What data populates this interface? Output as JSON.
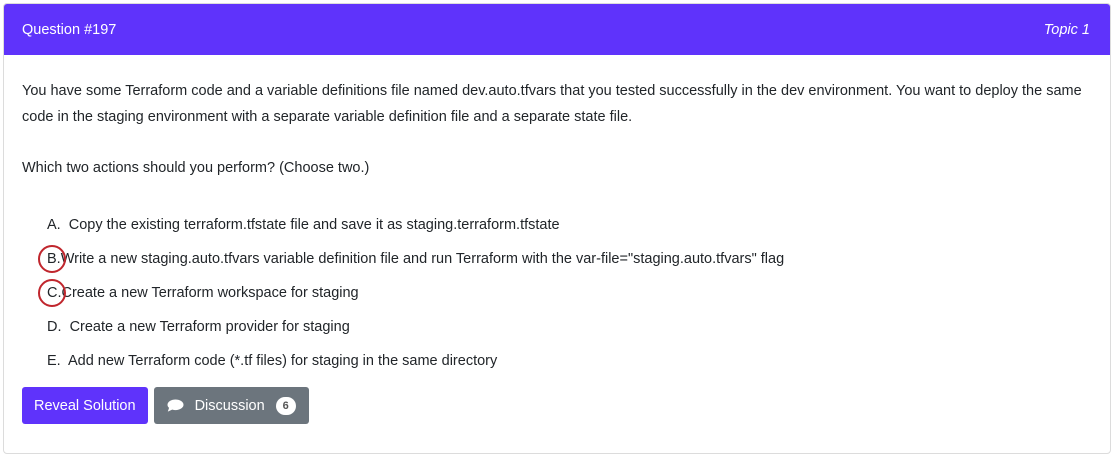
{
  "header": {
    "question_number": "Question #197",
    "topic": "Topic 1"
  },
  "question": {
    "paragraph1": "You have some Terraform code and a variable definitions file named dev.auto.tfvars that you tested successfully in the dev environment. You want to deploy the same code in the staging environment with a separate variable definition file and a separate state file.",
    "paragraph2": "Which two actions should you perform? (Choose two.)"
  },
  "choices": [
    {
      "letter": "A.",
      "text": "Copy the existing terraform.tfstate file and save it as staging.terraform.tfstate",
      "voted": false
    },
    {
      "letter": "B.",
      "text": "Write a new staging.auto.tfvars variable definition file and run Terraform with the var-file=\"staging.auto.tfvars\" flag",
      "voted": true
    },
    {
      "letter": "C.",
      "text": "Create a new Terraform workspace for staging",
      "voted": true
    },
    {
      "letter": "D.",
      "text": "Create a new Terraform provider for staging",
      "voted": false
    },
    {
      "letter": "E.",
      "text": "Add new Terraform code (*.tf files) for staging in the same directory",
      "voted": false
    }
  ],
  "actions": {
    "reveal_label": "Reveal Solution",
    "discussion_label": "Discussion",
    "discussion_count": "6",
    "discussion_icon": "comment-icon"
  },
  "colors": {
    "accent": "#5f33fb",
    "secondary": "#6c757d",
    "vote_circle": "#c0262d"
  }
}
